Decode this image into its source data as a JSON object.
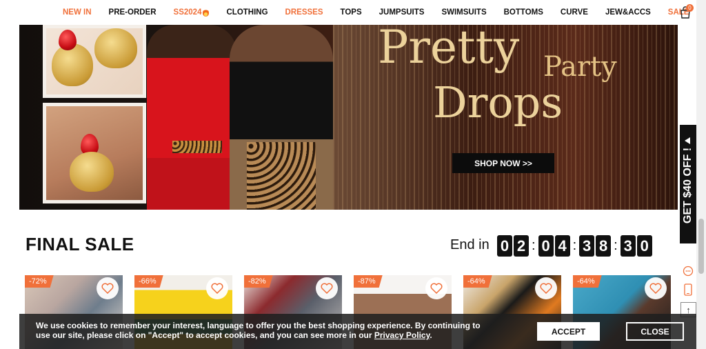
{
  "nav": {
    "items": [
      {
        "label": "NEW IN",
        "highlight": true
      },
      {
        "label": "PRE-ORDER",
        "highlight": false
      },
      {
        "label": "SS2024",
        "highlight": true,
        "icon": "fire-icon"
      },
      {
        "label": "CLOTHING",
        "highlight": false
      },
      {
        "label": "DRESSES",
        "highlight": true
      },
      {
        "label": "TOPS",
        "highlight": false
      },
      {
        "label": "JUMPSUITS",
        "highlight": false
      },
      {
        "label": "SWIMSUITS",
        "highlight": false
      },
      {
        "label": "BOTTOMS",
        "highlight": false
      },
      {
        "label": "CURVE",
        "highlight": false
      },
      {
        "label": "JEW&ACCS",
        "highlight": false
      },
      {
        "label": "SALE",
        "highlight": true
      }
    ],
    "cart_icon": "shopping-bag-icon",
    "cart_count": "0"
  },
  "hero": {
    "headline_1": "Pretty",
    "headline_2": "Party",
    "headline_3": "Drops",
    "cta": "SHOP NOW >>"
  },
  "promo_tab": {
    "label": "GET $40 OFF !"
  },
  "final_sale": {
    "title": "FINAL SALE",
    "end_in_label": "End in",
    "countdown": {
      "hours": [
        "0",
        "2"
      ],
      "minutes": [
        "0",
        "4"
      ],
      "seconds": [
        "3",
        "8"
      ],
      "frames": [
        "3",
        "0"
      ]
    }
  },
  "products": [
    {
      "discount": "-72%"
    },
    {
      "discount": "-66%"
    },
    {
      "discount": "-82%"
    },
    {
      "discount": "-87%"
    },
    {
      "discount": "-64%"
    },
    {
      "discount": "-64%"
    }
  ],
  "cookie": {
    "text_before": "We use cookies to remember your interest, language to offer you the best shopping experience. By continuing to use our site, please click on \"Accept\" to accept cookies, and you can see more in our ",
    "policy_link": "Privacy Policy",
    "text_after": ".",
    "accept_label": "ACCEPT",
    "close_label": "CLOSE"
  },
  "colors": {
    "accent": "#f0703a",
    "dark": "#111111"
  }
}
